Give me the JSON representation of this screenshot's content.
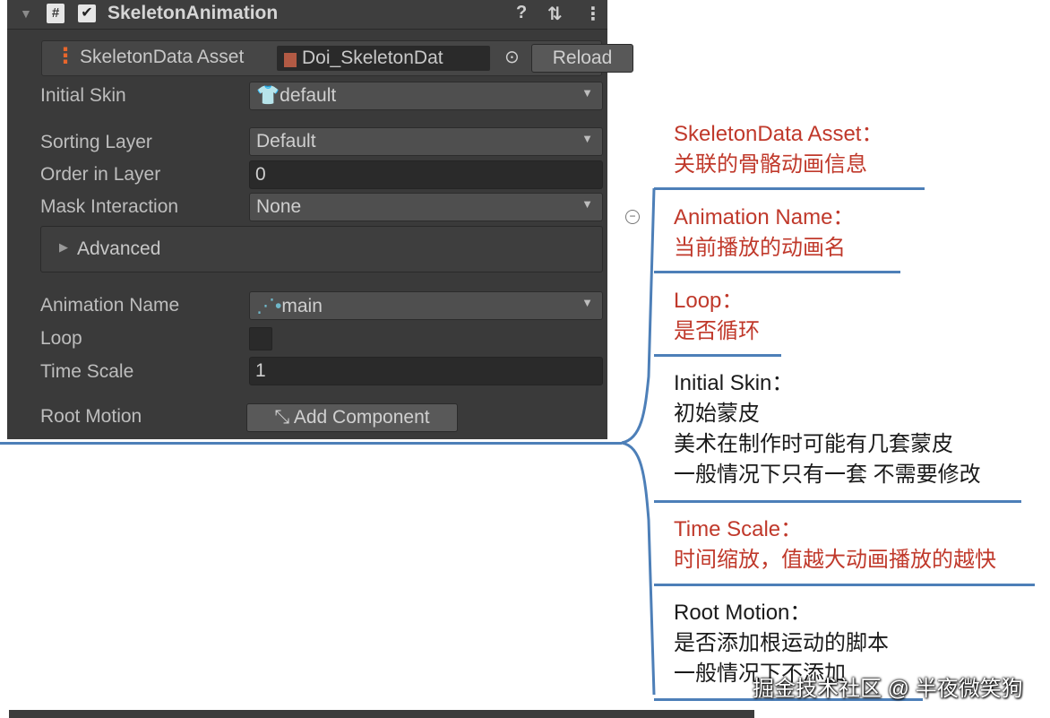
{
  "inspector": {
    "component_title": "SkeletonAnimation",
    "header_icons": {
      "help": "?",
      "presets": "⇅",
      "menu": "⋮"
    },
    "skeleton_data": {
      "label": "SkeletonData Asset",
      "value": "Doi_SkeletonDat",
      "button": "Reload"
    },
    "initial_skin": {
      "label": "Initial Skin",
      "value": "default"
    },
    "sorting_layer": {
      "label": "Sorting Layer",
      "value": "Default"
    },
    "order_in_layer": {
      "label": "Order in Layer",
      "value": "0"
    },
    "mask_interaction": {
      "label": "Mask Interaction",
      "value": "None"
    },
    "advanced": {
      "label": "Advanced"
    },
    "animation_name": {
      "label": "Animation Name",
      "value": "main"
    },
    "loop": {
      "label": "Loop",
      "checked": false
    },
    "time_scale": {
      "label": "Time Scale",
      "value": "1"
    },
    "root_motion": {
      "label": "Root Motion",
      "button": "Add Component"
    }
  },
  "annotations": [
    {
      "title": "SkeletonData Asset：",
      "lines": [
        "关联的骨骼动画信息"
      ],
      "color": "#c0392b"
    },
    {
      "title": "Animation Name：",
      "lines": [
        "当前播放的动画名"
      ],
      "color": "#c0392b"
    },
    {
      "title": "Loop：",
      "lines": [
        "是否循环"
      ],
      "color": "#c0392b"
    },
    {
      "title": "Initial Skin：",
      "lines": [
        "初始蒙皮",
        "美术在制作时可能有几套蒙皮",
        "一般情况下只有一套 不需要修改"
      ],
      "color": "#1a1a1a"
    },
    {
      "title": "Time Scale：",
      "lines": [
        "时间缩放，值越大动画播放的越快"
      ],
      "color": "#c0392b"
    },
    {
      "title": "Root Motion：",
      "lines": [
        "是否添加根运动的脚本",
        "一般情况下不添加"
      ],
      "color": "#1a1a1a"
    }
  ],
  "watermark": "掘金技术社区 @ 半夜微笑狗",
  "colors": {
    "accent_line": "#4d7fb8",
    "annotation_red": "#c0392b",
    "panel_bg": "#3a3a3a"
  }
}
